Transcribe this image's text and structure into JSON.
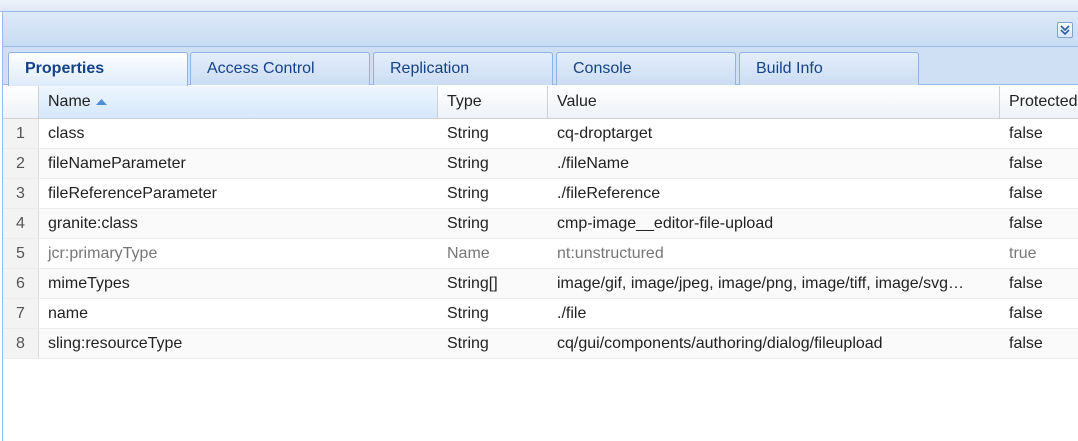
{
  "tabs": [
    {
      "label": "Properties",
      "active": true
    },
    {
      "label": "Access Control",
      "active": false
    },
    {
      "label": "Replication",
      "active": false
    },
    {
      "label": "Console",
      "active": false
    },
    {
      "label": "Build Info",
      "active": false
    }
  ],
  "header": {
    "collapse_icon": "double-chevron-down-icon"
  },
  "grid": {
    "columns": {
      "name": "Name",
      "type": "Type",
      "value": "Value",
      "protected": "Protected"
    },
    "sort": {
      "column": "Name",
      "direction": "ascending",
      "icon": "sort-ascending-icon"
    },
    "rows": [
      {
        "num": "1",
        "name": "class",
        "type": "String",
        "value": "cq-droptarget",
        "protected": "false"
      },
      {
        "num": "2",
        "name": "fileNameParameter",
        "type": "String",
        "value": "./fileName",
        "protected": "false"
      },
      {
        "num": "3",
        "name": "fileReferenceParameter",
        "type": "String",
        "value": "./fileReference",
        "protected": "false"
      },
      {
        "num": "4",
        "name": "granite:class",
        "type": "String",
        "value": "cmp-image__editor-file-upload",
        "protected": "false"
      },
      {
        "num": "5",
        "name": "jcr:primaryType",
        "type": "Name",
        "value": "nt:unstructured",
        "protected": "true"
      },
      {
        "num": "6",
        "name": "mimeTypes",
        "type": "String[]",
        "value": "image/gif, image/jpeg, image/png, image/tiff, image/svg…",
        "protected": "false"
      },
      {
        "num": "7",
        "name": "name",
        "type": "String",
        "value": "./file",
        "protected": "false"
      },
      {
        "num": "8",
        "name": "sling:resourceType",
        "type": "String",
        "value": "cq/gui/components/authoring/dialog/fileupload",
        "protected": "false"
      }
    ]
  },
  "colors": {
    "tab_text": "#15428b",
    "panel_border": "#99bbe8",
    "muted_text": "#777777"
  }
}
